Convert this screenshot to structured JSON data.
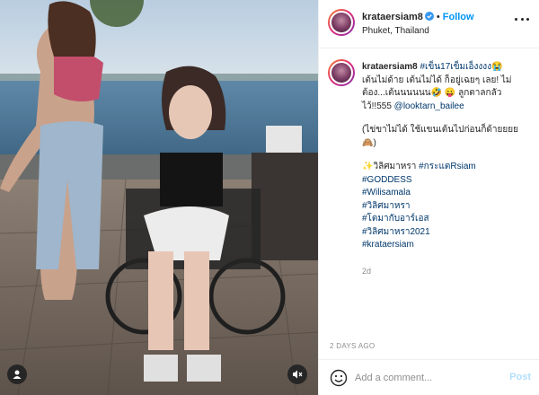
{
  "post": {
    "username": "krataersiam8",
    "follow_label": "Follow",
    "location": "Phuket, Thailand",
    "caption": {
      "username": "krataersiam8",
      "hashtag_intro": "#เข็น17เข็มเอ็งงงง😭",
      "text_1": "เต้นไม่ด้าย เต้นไม่ได้ ก็อยู่เฉยๆ เลย! ไม่ต้อง...เต้นนนนนน🤣 😛 ลูกตาลกลัวไว้!!555",
      "mention": "@looktarn_bailee",
      "text_2": "(ไข่ขาไม่ได้ ใช้แขนเต้นไปก่อนก็ด้ายยยย🙈)",
      "sparkle_line_prefix": "✨วิลิศมาหรา",
      "sparkle_line_tag": "#กระแตRsiam",
      "tags": [
        "#GODDESS",
        "#Wilisamala",
        "#วิลิศมาหรา",
        "#โตมากับอาร์เอส",
        "#วิลิศมาหรา2021",
        "#krataersiam"
      ],
      "age": "2d"
    },
    "timestamp": "2 DAYS AGO"
  },
  "comment": {
    "placeholder": "Add a comment...",
    "post_label": "Post"
  },
  "icons": {
    "verified": "verified-badge-icon",
    "more": "more-options-icon",
    "emoji": "emoji-icon",
    "user_tag": "user-tag-icon",
    "mute": "sound-muted-icon"
  },
  "colors": {
    "accent": "#0095f6",
    "link": "#00376b",
    "muted": "#8e8e8e",
    "post_disabled": "#b2dffc"
  }
}
